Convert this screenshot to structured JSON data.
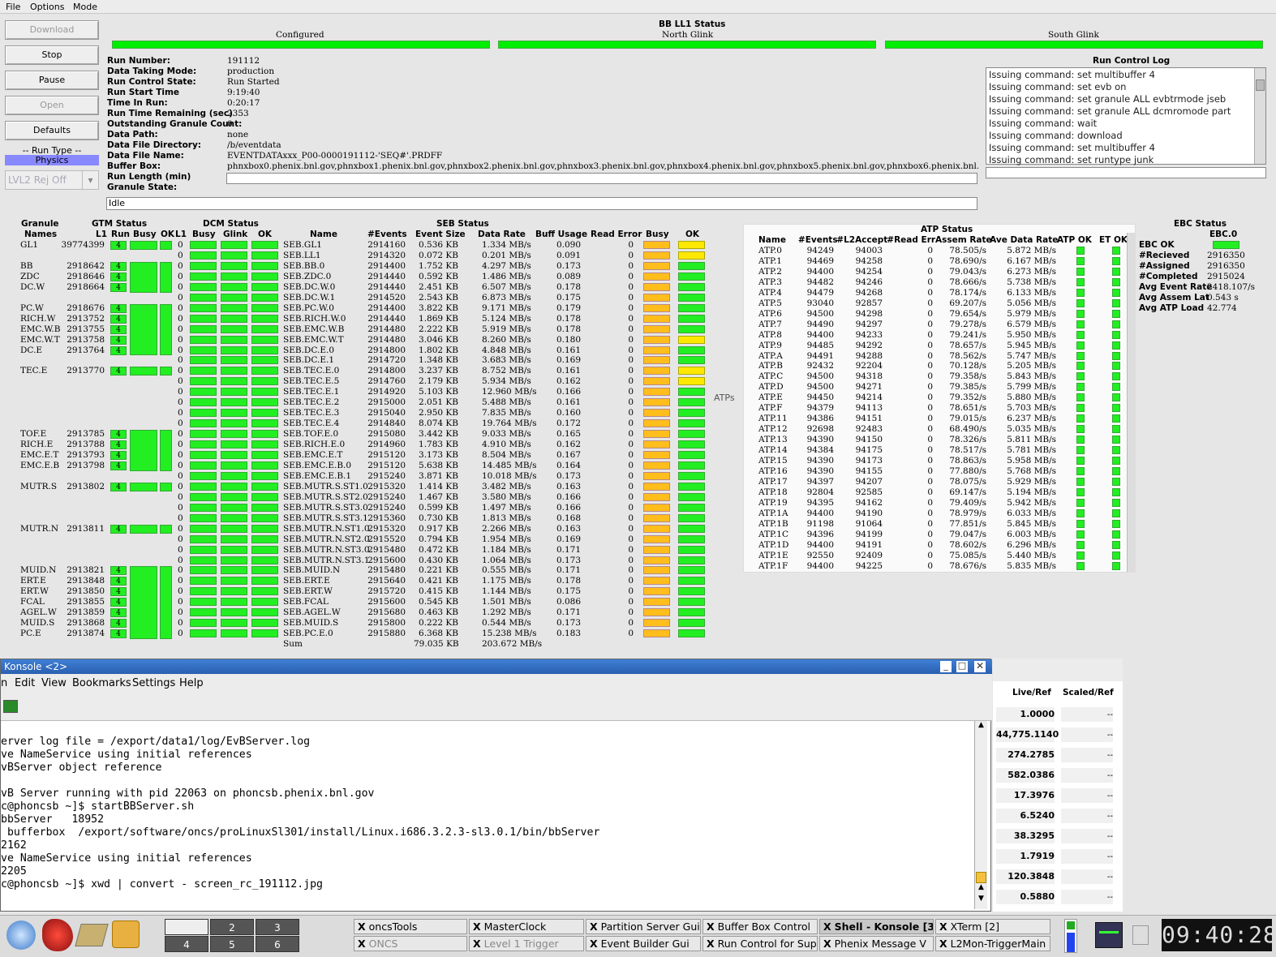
{
  "menu": [
    "File",
    "Options",
    "Mode"
  ],
  "buttons": {
    "download": "Download",
    "stop": "Stop",
    "pause": "Pause",
    "open": "Open",
    "defaults": "Defaults",
    "run_type_label": "-- Run Type --",
    "run_type_value": "Physics",
    "lvl2": "LVL2 Rej Off"
  },
  "bb_status": {
    "title": "BB LL1 Status",
    "configured": "Configured",
    "north": "North Glink",
    "south": "South Glink"
  },
  "run_info": [
    [
      "Run Number:",
      "191112"
    ],
    [
      "Data Taking Mode:",
      "production"
    ],
    [
      "Run Control State:",
      "Run Started"
    ],
    [
      "Run Start Time",
      "9:19:40"
    ],
    [
      "Time In Run:",
      "0:20:17"
    ],
    [
      "Run Time Remaining (sec)",
      "2353"
    ],
    [
      "Outstanding Granule Count:",
      "0"
    ],
    [
      "Data Path:",
      "none"
    ],
    [
      "Data File Directory:",
      "/b/eventdata"
    ],
    [
      "Data File Name:",
      "EVENTDATAxxx_P00-0000191112-'SEQ#'.PRDFF"
    ],
    [
      "Buffer Box:",
      "phnxbox0.phenix.bnl.gov,phnxbox1.phenix.bnl.gov,phnxbox2.phenix.bnl.gov,phnxbox3.phenix.bnl.gov,phnxbox4.phenix.bnl.gov,phnxbox5.phenix.bnl.gov,phnxbox6.phenix.bnl.gov"
    ],
    [
      "Run Length (min)",
      ""
    ],
    [
      "Granule State:",
      ""
    ]
  ],
  "granule_state": "Idle",
  "log": {
    "title": "Run Control Log",
    "lines": [
      "Issuing command: set multibuffer 4",
      "Issuing command: set evb on",
      "Issuing command: set granule ALL evbtrmode jseb",
      "Issuing command: set granule ALL dcmromode part",
      "Issuing command: wait",
      "Issuing command: download",
      "Issuing command: set multibuffer 4",
      "Issuing command: set runtype junk"
    ]
  },
  "granule_headers": {
    "granule": "Granule",
    "names": "Names",
    "gtm": "GTM Status",
    "l1": "L1",
    "run": "Run",
    "busy": "Busy",
    "ok": "OK",
    "l1b": "L1",
    "dcm": "DCM Status",
    "dbusy": "Busy",
    "glink": "Glink",
    "dok": "OK",
    "seb": "SEB Status",
    "name": "Name",
    "events": "#Events",
    "evsize": "Event Size",
    "rate": "Data Rate",
    "buff": "Buff Usage",
    "readerr": "Read Error",
    "sbusy": "Busy",
    "sok": "OK"
  },
  "granules": [
    {
      "name": "GL1",
      "l1": "39774399",
      "run": "4"
    },
    {
      "name": "BB",
      "l1": "2918642",
      "run": "4"
    },
    {
      "name": "ZDC",
      "l1": "2918646",
      "run": "4"
    },
    {
      "name": "DC.W",
      "l1": "2918664",
      "run": "4"
    },
    {
      "name": "PC.W",
      "l1": "2918676",
      "run": "4"
    },
    {
      "name": "RICH.W",
      "l1": "2913752",
      "run": "4"
    },
    {
      "name": "EMC.W.B",
      "l1": "2913755",
      "run": "4"
    },
    {
      "name": "EMC.W.T",
      "l1": "2913758",
      "run": "4"
    },
    {
      "name": "DC.E",
      "l1": "2913764",
      "run": "4"
    },
    {
      "name": "TEC.E",
      "l1": "2913770",
      "run": "4"
    },
    {
      "name": "TOF.E",
      "l1": "2913785",
      "run": "4"
    },
    {
      "name": "RICH.E",
      "l1": "2913788",
      "run": "4"
    },
    {
      "name": "EMC.E.T",
      "l1": "2913793",
      "run": "4"
    },
    {
      "name": "EMC.E.B",
      "l1": "2913798",
      "run": "4"
    },
    {
      "name": "MUTR.S",
      "l1": "2913802",
      "run": "4"
    },
    {
      "name": "MUTR.N",
      "l1": "2913811",
      "run": "4"
    },
    {
      "name": "MUID.N",
      "l1": "2913821",
      "run": "4"
    },
    {
      "name": "ERT.E",
      "l1": "2913848",
      "run": "4"
    },
    {
      "name": "ERT.W",
      "l1": "2913850",
      "run": "4"
    },
    {
      "name": "FCAL",
      "l1": "2913855",
      "run": "4"
    },
    {
      "name": "AGEL.W",
      "l1": "2913859",
      "run": "4"
    },
    {
      "name": "MUID.S",
      "l1": "2913868",
      "run": "4"
    },
    {
      "name": "PC.E",
      "l1": "2913874",
      "run": "4"
    }
  ],
  "seb": [
    [
      "0",
      "SEB.GL1",
      "2914160",
      "0.536 KB",
      "1.334 MB/s",
      "0.090",
      "0",
      "y"
    ],
    [
      "0",
      "SEB.LL1",
      "2914320",
      "0.072 KB",
      "0.201 MB/s",
      "0.091",
      "0",
      "y"
    ],
    [
      "0",
      "SEB.BB.0",
      "2914400",
      "1.752 KB",
      "4.297 MB/s",
      "0.173",
      "0",
      "g"
    ],
    [
      "0",
      "SEB.ZDC.0",
      "2914440",
      "0.592 KB",
      "1.486 MB/s",
      "0.089",
      "0",
      "g"
    ],
    [
      "0",
      "SEB.DC.W.0",
      "2914440",
      "2.451 KB",
      "6.507 MB/s",
      "0.178",
      "0",
      "g"
    ],
    [
      "0",
      "SEB.DC.W.1",
      "2914520",
      "2.543 KB",
      "6.873 MB/s",
      "0.175",
      "0",
      "g"
    ],
    [
      "0",
      "SEB.PC.W.0",
      "2914400",
      "3.822 KB",
      "9.171 MB/s",
      "0.179",
      "0",
      "g"
    ],
    [
      "0",
      "SEB.RICH.W.0",
      "2914440",
      "1.869 KB",
      "5.124 MB/s",
      "0.178",
      "0",
      "g"
    ],
    [
      "0",
      "SEB.EMC.W.B",
      "2914480",
      "2.222 KB",
      "5.919 MB/s",
      "0.178",
      "0",
      "g"
    ],
    [
      "0",
      "SEB.EMC.W.T",
      "2914480",
      "3.046 KB",
      "8.260 MB/s",
      "0.180",
      "0",
      "y"
    ],
    [
      "0",
      "SEB.DC.E.0",
      "2914800",
      "1.802 KB",
      "4.848 MB/s",
      "0.161",
      "0",
      "g"
    ],
    [
      "0",
      "SEB.DC.E.1",
      "2914720",
      "1.348 KB",
      "3.683 MB/s",
      "0.169",
      "0",
      "g"
    ],
    [
      "0",
      "SEB.TEC.E.0",
      "2914800",
      "3.237 KB",
      "8.752 MB/s",
      "0.161",
      "0",
      "y"
    ],
    [
      "0",
      "SEB.TEC.E.5",
      "2914760",
      "2.179 KB",
      "5.934 MB/s",
      "0.162",
      "0",
      "y"
    ],
    [
      "0",
      "SEB.TEC.E.1",
      "2914920",
      "5.103 KB",
      "12.960 MB/s",
      "0.166",
      "0",
      "g"
    ],
    [
      "0",
      "SEB.TEC.E.2",
      "2915000",
      "2.051 KB",
      "5.488 MB/s",
      "0.161",
      "0",
      "g"
    ],
    [
      "0",
      "SEB.TEC.E.3",
      "2915040",
      "2.950 KB",
      "7.835 MB/s",
      "0.160",
      "0",
      "g"
    ],
    [
      "0",
      "SEB.TEC.E.4",
      "2914840",
      "8.074 KB",
      "19.764 MB/s",
      "0.172",
      "0",
      "g"
    ],
    [
      "0",
      "SEB.TOF.E.0",
      "2915080",
      "3.442 KB",
      "9.033 MB/s",
      "0.165",
      "0",
      "g"
    ],
    [
      "0",
      "SEB.RICH.E.0",
      "2914960",
      "1.783 KB",
      "4.910 MB/s",
      "0.162",
      "0",
      "g"
    ],
    [
      "0",
      "SEB.EMC.E.T",
      "2915120",
      "3.173 KB",
      "8.504 MB/s",
      "0.167",
      "0",
      "g"
    ],
    [
      "0",
      "SEB.EMC.E.B.0",
      "2915120",
      "5.638 KB",
      "14.485 MB/s",
      "0.164",
      "0",
      "g"
    ],
    [
      "0",
      "SEB.EMC.E.B.1",
      "2915240",
      "3.871 KB",
      "10.018 MB/s",
      "0.173",
      "0",
      "g"
    ],
    [
      "0",
      "SEB.MUTR.S.ST1.0",
      "2915320",
      "1.414 KB",
      "3.482 MB/s",
      "0.163",
      "0",
      "g"
    ],
    [
      "0",
      "SEB.MUTR.S.ST2.0",
      "2915240",
      "1.467 KB",
      "3.580 MB/s",
      "0.166",
      "0",
      "g"
    ],
    [
      "0",
      "SEB.MUTR.S.ST3.0",
      "2915240",
      "0.599 KB",
      "1.497 MB/s",
      "0.166",
      "0",
      "g"
    ],
    [
      "0",
      "SEB.MUTR.S.ST3.1",
      "2915360",
      "0.730 KB",
      "1.813 MB/s",
      "0.168",
      "0",
      "g"
    ],
    [
      "0",
      "SEB.MUTR.N.ST1.0",
      "2915320",
      "0.917 KB",
      "2.266 MB/s",
      "0.163",
      "0",
      "g"
    ],
    [
      "0",
      "SEB.MUTR.N.ST2.0",
      "2915520",
      "0.794 KB",
      "1.954 MB/s",
      "0.169",
      "0",
      "g"
    ],
    [
      "0",
      "SEB.MUTR.N.ST3.0",
      "2915480",
      "0.472 KB",
      "1.184 MB/s",
      "0.171",
      "0",
      "g"
    ],
    [
      "0",
      "SEB.MUTR.N.ST3.1",
      "2915600",
      "0.430 KB",
      "1.064 MB/s",
      "0.173",
      "0",
      "g"
    ],
    [
      "0",
      "SEB.MUID.N",
      "2915480",
      "0.221 KB",
      "0.555 MB/s",
      "0.171",
      "0",
      "g"
    ],
    [
      "0",
      "SEB.ERT.E",
      "2915640",
      "0.421 KB",
      "1.175 MB/s",
      "0.178",
      "0",
      "g"
    ],
    [
      "0",
      "SEB.ERT.W",
      "2915720",
      "0.415 KB",
      "1.144 MB/s",
      "0.175",
      "0",
      "g"
    ],
    [
      "0",
      "SEB.FCAL",
      "2915600",
      "0.545 KB",
      "1.501 MB/s",
      "0.086",
      "0",
      "g"
    ],
    [
      "0",
      "SEB.AGEL.W",
      "2915680",
      "0.463 KB",
      "1.292 MB/s",
      "0.171",
      "0",
      "g"
    ],
    [
      "0",
      "SEB.MUID.S",
      "2915800",
      "0.222 KB",
      "0.544 MB/s",
      "0.173",
      "0",
      "g"
    ],
    [
      "0",
      "SEB.PC.E.0",
      "2915880",
      "6.368 KB",
      "15.238 MB/s",
      "0.183",
      "0",
      "g"
    ]
  ],
  "seb_sum": {
    "label": "Sum",
    "size": "79.035 KB",
    "rate": "203.672 MB/s"
  },
  "atps_label": "ATPs",
  "atp": {
    "title": "ATP Status",
    "headers": [
      "Name",
      "#Events",
      "#L2Accept",
      "#Read Err",
      "Assem Rate",
      "Ave Data Rate",
      "ATP OK",
      "ET OK"
    ],
    "rows": [
      [
        "ATP.0",
        "94249",
        "94003",
        "0",
        "78.505/s",
        "5.872 MB/s"
      ],
      [
        "ATP.1",
        "94469",
        "94258",
        "0",
        "78.690/s",
        "6.167 MB/s"
      ],
      [
        "ATP.2",
        "94400",
        "94254",
        "0",
        "79.043/s",
        "6.273 MB/s"
      ],
      [
        "ATP.3",
        "94482",
        "94246",
        "0",
        "78.666/s",
        "5.738 MB/s"
      ],
      [
        "ATP.4",
        "94479",
        "94268",
        "0",
        "78.174/s",
        "6.133 MB/s"
      ],
      [
        "ATP.5",
        "93040",
        "92857",
        "0",
        "69.207/s",
        "5.056 MB/s"
      ],
      [
        "ATP.6",
        "94500",
        "94298",
        "0",
        "79.654/s",
        "5.979 MB/s"
      ],
      [
        "ATP.7",
        "94490",
        "94297",
        "0",
        "79.278/s",
        "6.579 MB/s"
      ],
      [
        "ATP.8",
        "94400",
        "94233",
        "0",
        "79.241/s",
        "5.950 MB/s"
      ],
      [
        "ATP.9",
        "94485",
        "94292",
        "0",
        "78.657/s",
        "5.945 MB/s"
      ],
      [
        "ATP.A",
        "94491",
        "94288",
        "0",
        "78.562/s",
        "5.747 MB/s"
      ],
      [
        "ATP.B",
        "92432",
        "92204",
        "0",
        "70.128/s",
        "5.205 MB/s"
      ],
      [
        "ATP.C",
        "94500",
        "94318",
        "0",
        "79.358/s",
        "5.843 MB/s"
      ],
      [
        "ATP.D",
        "94500",
        "94271",
        "0",
        "79.385/s",
        "5.799 MB/s"
      ],
      [
        "ATP.E",
        "94450",
        "94214",
        "0",
        "79.352/s",
        "5.880 MB/s"
      ],
      [
        "ATP.F",
        "94379",
        "94113",
        "0",
        "78.651/s",
        "5.703 MB/s"
      ],
      [
        "ATP.11",
        "94386",
        "94151",
        "0",
        "79.015/s",
        "6.237 MB/s"
      ],
      [
        "ATP.12",
        "92698",
        "92483",
        "0",
        "68.490/s",
        "5.035 MB/s"
      ],
      [
        "ATP.13",
        "94390",
        "94150",
        "0",
        "78.326/s",
        "5.811 MB/s"
      ],
      [
        "ATP.14",
        "94384",
        "94175",
        "0",
        "78.517/s",
        "5.781 MB/s"
      ],
      [
        "ATP.15",
        "94390",
        "94173",
        "0",
        "78.863/s",
        "5.958 MB/s"
      ],
      [
        "ATP.16",
        "94390",
        "94155",
        "0",
        "77.880/s",
        "5.768 MB/s"
      ],
      [
        "ATP.17",
        "94397",
        "94207",
        "0",
        "78.075/s",
        "5.929 MB/s"
      ],
      [
        "ATP.18",
        "92804",
        "92585",
        "0",
        "69.147/s",
        "5.194 MB/s"
      ],
      [
        "ATP.19",
        "94395",
        "94162",
        "0",
        "79.409/s",
        "5.942 MB/s"
      ],
      [
        "ATP.1A",
        "94400",
        "94190",
        "0",
        "78.979/s",
        "6.033 MB/s"
      ],
      [
        "ATP.1B",
        "91198",
        "91064",
        "0",
        "77.851/s",
        "5.845 MB/s"
      ],
      [
        "ATP.1C",
        "94396",
        "94199",
        "0",
        "79.047/s",
        "6.003 MB/s"
      ],
      [
        "ATP.1D",
        "94400",
        "94191",
        "0",
        "78.602/s",
        "6.296 MB/s"
      ],
      [
        "ATP.1E",
        "92550",
        "92409",
        "0",
        "75.085/s",
        "5.440 MB/s"
      ],
      [
        "ATP.1F",
        "94400",
        "94225",
        "0",
        "78.676/s",
        "5.835 MB/s"
      ]
    ]
  },
  "ebc": {
    "title": "EBC Status",
    "col": "EBC.0",
    "rows": [
      [
        "EBC OK",
        ""
      ],
      [
        "#Recieved",
        "2916350"
      ],
      [
        "#Assigned",
        "2916350"
      ],
      [
        "#Completed",
        "2915024"
      ],
      [
        "Avg Event Rate",
        "2418.107/s"
      ],
      [
        "Avg Assem Lat",
        "0.543 s"
      ],
      [
        "Avg ATP Load",
        "42.774"
      ]
    ]
  },
  "konsole": {
    "title": "Konsole <2>",
    "menu": [
      "n",
      "Edit",
      "View",
      "Bookmarks",
      "Settings",
      "Help"
    ],
    "lines": [
      "erver log file = /export/data1/log/EvBServer.log",
      "ve NameService using initial references",
      "vBServer object reference",
      "",
      "vB Server running with pid 22063 on phoncsb.phenix.bnl.gov",
      "c@phoncsb ~]$ startBBServer.sh",
      "bbServer   18952",
      " bufferbox  /export/software/oncs/proLinuxSl301/install/Linux.i686.3.2.3-sl3.0.1/bin/bbServer",
      "2162",
      "ve NameService using initial references",
      "2205",
      "c@phoncsb ~]$ xwd | convert - screen_rc_191112.jpg"
    ]
  },
  "scaler": {
    "h1": "Live/Ref",
    "h2": "Scaled/Ref",
    "values": [
      "1.0000",
      "44,775.1140",
      "274.2785",
      "582.0386",
      "17.3976",
      "6.5240",
      "38.3295",
      "1.7919",
      "120.3848",
      "0.5880"
    ],
    "dash": "--"
  },
  "taskbar": {
    "desks": [
      "2",
      "3",
      "4",
      "5",
      "6"
    ],
    "tasks": [
      [
        "oncsTools",
        "ONCS"
      ],
      [
        "MasterClock",
        "Level 1 Trigger"
      ],
      [
        "Partition Server Gui",
        "Event Builder Gui"
      ],
      [
        "Buffer Box Control",
        "Run Control for Supe"
      ],
      [
        "Shell - Konsole [3]",
        "Phenix Message V"
      ],
      [
        "XTerm [2]",
        "L2Mon-TriggerMain"
      ]
    ],
    "clock": "09:40:28"
  }
}
